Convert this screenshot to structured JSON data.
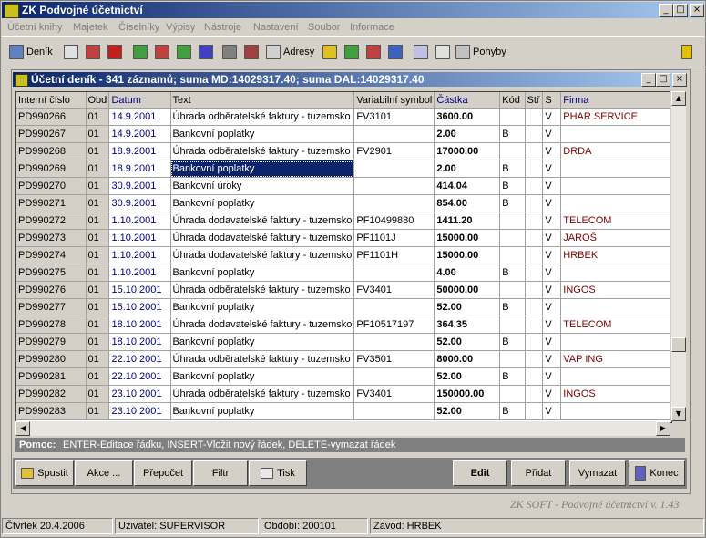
{
  "app": {
    "title": "ZK Podvojné účetnictví"
  },
  "menu": [
    "Účetní knihy",
    "Majetek",
    "Číselníky",
    "Výpisy",
    "Nástroje",
    "Nastavení",
    "Soubor",
    "Informace"
  ],
  "toolbar": {
    "denik": "Deník",
    "adresy": "Adresy",
    "pohyby": "Pohyby"
  },
  "window": {
    "title": "Účetní deník - 341 záznamů;  suma MD:14029317.40;  suma DAL:14029317.40"
  },
  "table": {
    "columns": [
      "Interní číslo",
      "Obd",
      "Datum",
      "Text",
      "Variabilní symbol",
      "Částka",
      "Kód",
      "Stř",
      "S",
      "Firma"
    ],
    "rows": [
      [
        "PD990266",
        "01",
        "14.9.2001",
        "Úhrada odběratelské faktury - tuzemsko",
        "FV3101",
        "3600.00",
        "",
        "",
        "V",
        "PHAR SERVICE"
      ],
      [
        "PD990267",
        "01",
        "14.9.2001",
        "Bankovní poplatky",
        "",
        "2.00",
        "B",
        "",
        "V",
        ""
      ],
      [
        "PD990268",
        "01",
        "18.9.2001",
        "Úhrada odběratelské faktury - tuzemsko",
        "FV2901",
        "17000.00",
        "",
        "",
        "V",
        "DRDA"
      ],
      [
        "PD990269",
        "01",
        "18.9.2001",
        "Bankovní poplatky",
        "",
        "2.00",
        "B",
        "",
        "V",
        ""
      ],
      [
        "PD990270",
        "01",
        "30.9.2001",
        "Bankovní úroky",
        "",
        "414.04",
        "B",
        "",
        "V",
        ""
      ],
      [
        "PD990271",
        "01",
        "30.9.2001",
        "Bankovní poplatky",
        "",
        "854.00",
        "B",
        "",
        "V",
        ""
      ],
      [
        "PD990272",
        "01",
        "1.10.2001",
        "Úhrada dodavatelské faktury - tuzemsko",
        "PF10499880",
        "1411.20",
        "",
        "",
        "V",
        "TELECOM"
      ],
      [
        "PD990273",
        "01",
        "1.10.2001",
        "Úhrada dodavatelské faktury - tuzemsko",
        "PF1101J",
        "15000.00",
        "",
        "",
        "V",
        "JAROŠ"
      ],
      [
        "PD990274",
        "01",
        "1.10.2001",
        "Úhrada dodavatelské faktury - tuzemsko",
        "PF1101H",
        "15000.00",
        "",
        "",
        "V",
        "HRBEK"
      ],
      [
        "PD990275",
        "01",
        "1.10.2001",
        "Bankovní poplatky",
        "",
        "4.00",
        "B",
        "",
        "V",
        ""
      ],
      [
        "PD990276",
        "01",
        "15.10.2001",
        "Úhrada odběratelské faktury - tuzemsko",
        "FV3401",
        "50000.00",
        "",
        "",
        "V",
        "INGOS"
      ],
      [
        "PD990277",
        "01",
        "15.10.2001",
        "Bankovní poplatky",
        "",
        "52.00",
        "B",
        "",
        "V",
        ""
      ],
      [
        "PD990278",
        "01",
        "18.10.2001",
        "Úhrada dodavatelské faktury - tuzemsko",
        "PF10517197",
        "364.35",
        "",
        "",
        "V",
        "TELECOM"
      ],
      [
        "PD990279",
        "01",
        "18.10.2001",
        "Bankovní poplatky",
        "",
        "52.00",
        "B",
        "",
        "V",
        ""
      ],
      [
        "PD990280",
        "01",
        "22.10.2001",
        "Úhrada odběratelské faktury - tuzemsko",
        "FV3501",
        "8000.00",
        "",
        "",
        "V",
        "VAP ING"
      ],
      [
        "PD990281",
        "01",
        "22.10.2001",
        "Bankovní poplatky",
        "",
        "52.00",
        "B",
        "",
        "V",
        ""
      ],
      [
        "PD990282",
        "01",
        "23.10.2001",
        "Úhrada odběratelské faktury - tuzemsko",
        "FV3401",
        "150000.00",
        "",
        "",
        "V",
        "INGOS"
      ],
      [
        "PD990283",
        "01",
        "23.10.2001",
        "Bankovní poplatky",
        "",
        "52.00",
        "B",
        "",
        "V",
        ""
      ]
    ],
    "selected_row": 3,
    "selected_col": 3
  },
  "help": {
    "label": "Pomoc:",
    "text": "ENTER-Editace řádku,  INSERT-Vložit nový řádek,  DELETE-vymazat řádek"
  },
  "buttons": {
    "spustit": "Spustit",
    "akce": "Akce ...",
    "prepocet": "Přepočet",
    "filtr": "Filtr",
    "tisk": "Tisk",
    "edit": "Edit",
    "pridat": "Přidat",
    "vymazat": "Vymazat",
    "konec": "Konec"
  },
  "brand": "ZK SOFT - Podvojné účetnictví v. 1.43",
  "status": {
    "date": "Čtvrtek 20.4.2006",
    "user": "Uživatel: SUPERVISOR",
    "period": "Období: 200101",
    "plant": "Závod: HRBEK"
  }
}
